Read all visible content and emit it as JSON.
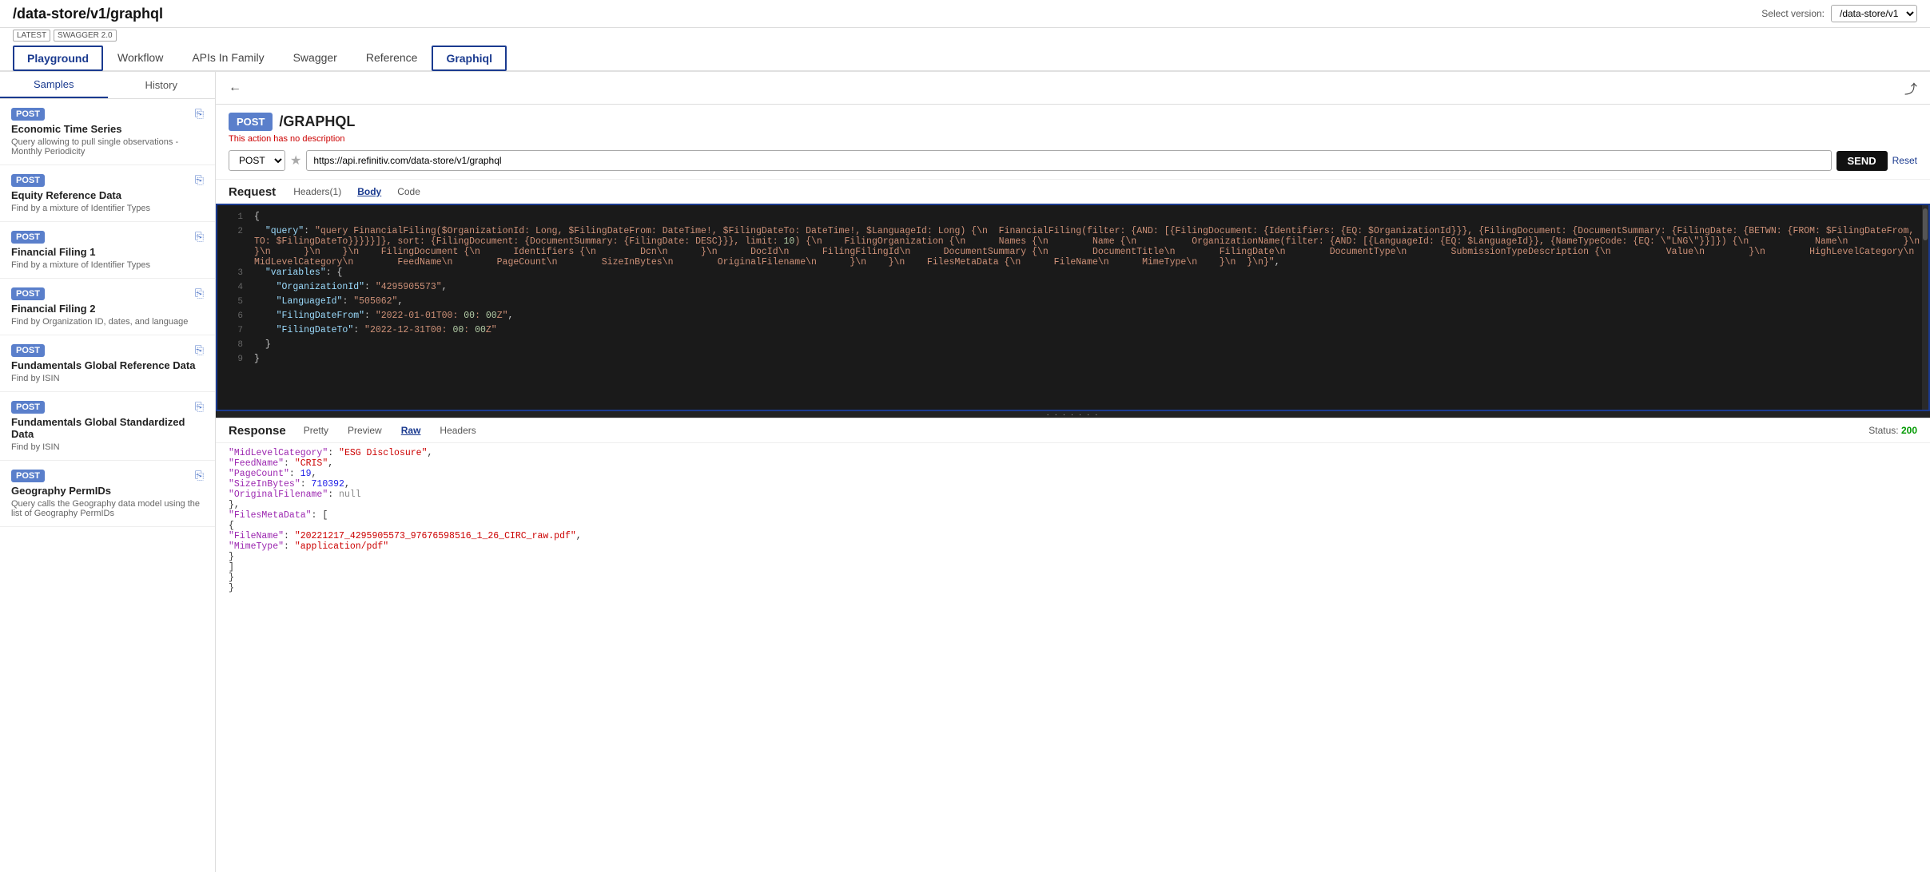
{
  "header": {
    "title": "/data-store/v1/graphql",
    "badges": [
      "LATEST",
      "SWAGGER 2.0"
    ],
    "version_label": "Select version:",
    "version_value": "/data-store/v1"
  },
  "nav": {
    "tabs": [
      "Playground",
      "Workflow",
      "APIs In Family",
      "Swagger",
      "Reference",
      "Graphiql"
    ],
    "active_tab": "Playground",
    "active_box_tab": "Graphiql"
  },
  "sidebar": {
    "tabs": [
      "Samples",
      "History"
    ],
    "active_tab": "Samples",
    "items": [
      {
        "method": "POST",
        "title": "Economic Time Series",
        "desc": "Query allowing to pull single observations - Monthly Periodicity"
      },
      {
        "method": "POST",
        "title": "Equity Reference Data",
        "desc": "Find by a mixture of Identifier Types"
      },
      {
        "method": "POST",
        "title": "Financial Filing 1",
        "desc": "Find by a mixture of Identifier Types"
      },
      {
        "method": "POST",
        "title": "Financial Filing 2",
        "desc": "Find by Organization ID, dates, and language"
      },
      {
        "method": "POST",
        "title": "Fundamentals Global Reference Data",
        "desc": "Find by ISIN"
      },
      {
        "method": "POST",
        "title": "Fundamentals Global Standardized Data",
        "desc": "Find by ISIN"
      },
      {
        "method": "POST",
        "title": "Geography PermIDs",
        "desc": "Query calls the Geography data model using the list of Geography PermIDs"
      }
    ]
  },
  "endpoint": {
    "method": "POST",
    "path": "/GRAPHQL",
    "no_desc": "This action has no description",
    "url": "https://api.refinitiv.com/data-store/v1/graphql",
    "send_label": "SEND",
    "reset_label": "Reset"
  },
  "request": {
    "section_title": "Request",
    "tabs": [
      "Headers(1)",
      "Body",
      "Code"
    ],
    "active_tab": "Body",
    "code_lines": [
      {
        "num": 1,
        "content": "{"
      },
      {
        "num": 2,
        "content": "  \"query\": \"query FinancialFiling($OrganizationId: Long, $FilingDateFrom: DateTime!, $FilingDateTo: DateTime!, $LanguageId: Long) {\\n  FinancialFiling(filter: {AND: [{FilingDocument: {Identifiers: {EQ: $OrganizationId}}}, {FilingDocument: {DocumentSummary: {FilingDate: {BETWN: {FROM: $FilingDateFrom, TO: $FilingDateTo}}}}}]}, sort: {FilingDocument: {DocumentSummary: {FilingDate: DESC}}}, limit: 10) {\\n    FilingOrganization {\\n      Names {\\n        Name {\\n          OrganizationName(filter: {AND: [{LanguageId: {EQ: $LanguageId}}, {NameTypeCode: {EQ: \\\"LNG\\\"}}]}) {\\n            Name\\n          }\\n        }\\n      }\\n    }\\n    FilingDocument {\\n      Identifiers {\\n        Dcn\\n      }\\n      DocId\\n      FilingFilingId\\n      DocumentSummary {\\n        DocumentTitle\\n        FilingDate\\n        DocumentType\\n        SubmissionTypeDescription {\\n          Value\\n        }\\n        HighLevelCategory\\n        MidLevelCategory\\n        FeedName\\n        PageCount\\n        SizeInBytes\\n        OriginalFilename\\n      }\\n    }\\n    FilesMetaData {\\n      FileName\\n      MimeType\\n    }\\n  }\\n}\","
      },
      {
        "num": 3,
        "content": "  \"variables\": {"
      },
      {
        "num": 4,
        "content": "    \"OrganizationId\": \"4295905573\","
      },
      {
        "num": 5,
        "content": "    \"LanguageId\": \"505062\","
      },
      {
        "num": 6,
        "content": "    \"FilingDateFrom\": \"2022-01-01T00:00:00Z\","
      },
      {
        "num": 7,
        "content": "    \"FilingDateTo\": \"2022-12-31T00:00:00Z\""
      },
      {
        "num": 8,
        "content": "  }"
      },
      {
        "num": 9,
        "content": "}"
      }
    ]
  },
  "response": {
    "section_title": "Response",
    "tabs": [
      "Pretty",
      "Preview",
      "Raw",
      "Headers"
    ],
    "active_tab": "Raw",
    "status_label": "Status:",
    "status_value": "200",
    "lines": [
      "      \"MidLevelCategory\": \"ESG Disclosure\",",
      "      \"FeedName\": \"CRIS\",",
      "      \"PageCount\": 19,",
      "      \"SizeInBytes\": 710392,",
      "      \"OriginalFilename\": null",
      "    },",
      "    \"FilesMetaData\": [",
      "      {",
      "        \"FileName\": \"20221217_4295905573_97676598516_1_26_CIRC_raw.pdf\",",
      "        \"MimeType\": \"application/pdf\"",
      "      }",
      "    ]",
      "  }",
      "}"
    ]
  }
}
